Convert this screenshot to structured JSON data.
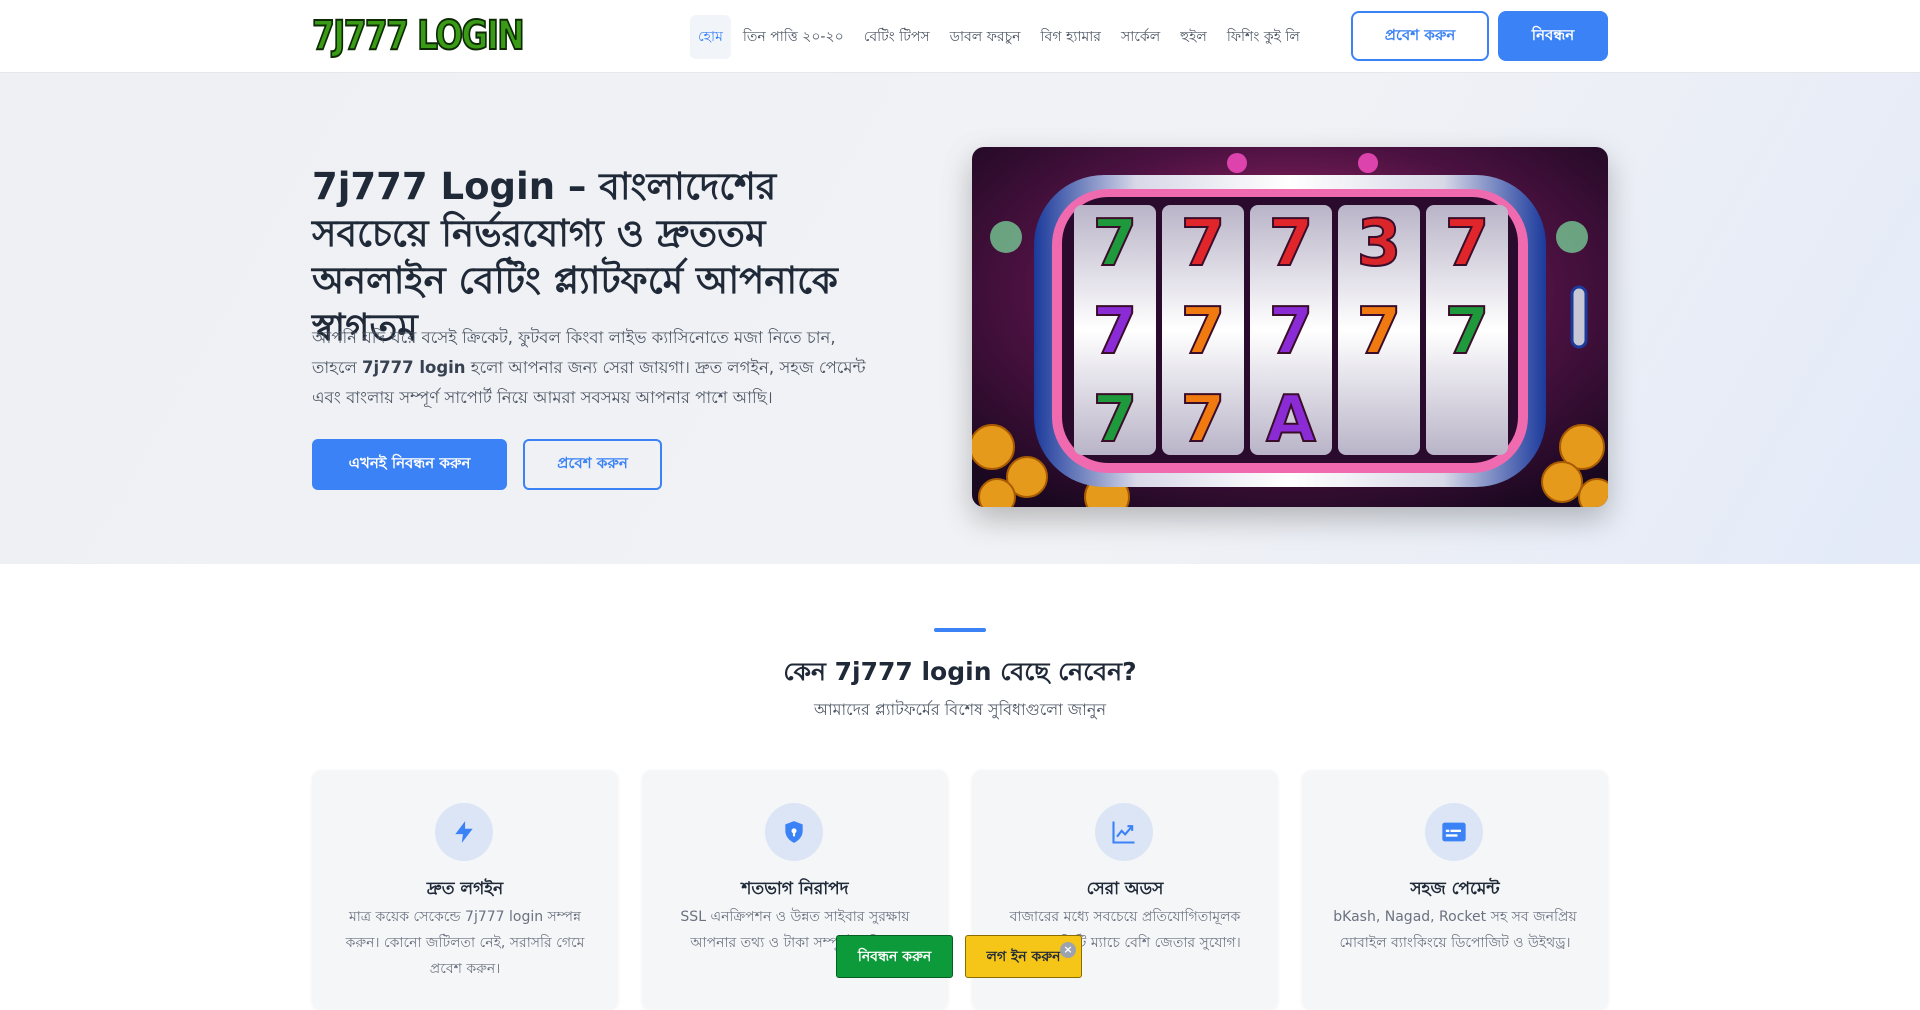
{
  "nav": {
    "logo_text": "7J777 LOGIN",
    "items": [
      "হোম",
      "তিন পাত্তি ২০-২০",
      "বেটিং টিপস",
      "ডাবল ফরচুন",
      "বিগ হ্যামার",
      "সার্কেল",
      "হুইল",
      "ফিশিং কুই লি"
    ],
    "active_index": 0,
    "login_label": "প্রবেশ করুন",
    "register_label": "নিবন্ধন"
  },
  "hero": {
    "title": "7j777 Login – বাংলাদেশের সবচেয়ে নির্ভরযোগ্য ও দ্রুততম অনলাইন বেটিং প্ল্যাটফর্মে আপনাকে স্বাগতম",
    "desc_before": "আপনি যদি ঘরে বসেই ক্রিকেট, ফুটবল কিংবা লাইভ ক্যাসিনোতে মজা নিতে চান, তাহলে ",
    "desc_bold": "7j777 login",
    "desc_after": " হলো আপনার জন্য সেরা জায়গা। দ্রুত লগইন, সহজ পেমেন্ট এবং বাংলায় সম্পূর্ণ সাপোর্ট নিয়ে আমরা সবসময় আপনার পাশে আছি।",
    "primary_button": "এখনই নিবন্ধন করুন",
    "secondary_button": "প্রবেশ করুন",
    "slot_reels": [
      [
        "7",
        "7",
        "7",
        "3",
        "7"
      ],
      [
        "7",
        "7",
        "7",
        "7",
        "7"
      ],
      [
        "7",
        "7",
        "A",
        "",
        ""
      ]
    ]
  },
  "features": {
    "title": "কেন 7j777 login বেছে নেবেন?",
    "subtitle": "আমাদের প্ল্যাটফর্মের বিশেষ সুবিধাগুলো জানুন",
    "cards": [
      {
        "icon": "lightning-icon",
        "title": "দ্রুত লগইন",
        "text": "মাত্র কয়েক সেকেন্ডে 7j777 login সম্পন্ন করুন। কোনো জটিলতা নেই, সরাসরি গেমে প্রবেশ করুন।"
      },
      {
        "icon": "shield-lock-icon",
        "title": "শতভাগ নিরাপদ",
        "text": "SSL এনক্রিপশন ও উন্নত সাইবার সুরক্ষায় আপনার তথ্য ও টাকা সম্পূর্ণ সুরক্ষিত।"
      },
      {
        "icon": "chart-trend-icon",
        "title": "সেরা অডস",
        "text": "বাজারের মধ্যে সবচেয়ে প্রতিযোগিতামূলক অডস, প্রতিটি ম্যাচে বেশি জেতার সুযোগ।"
      },
      {
        "icon": "card-payment-icon",
        "title": "সহজ পেমেন্ট",
        "text": "bKash, Nagad, Rocket সহ সব জনপ্রিয় মোবাইল ব্যাংকিংয়ে ডিপোজিট ও উইথড্র।"
      }
    ]
  },
  "floating": {
    "register_label": "নিবন্ধন করুন",
    "login_label": "লগ ইন করুন",
    "close_glyph": "×"
  },
  "colors": {
    "accent": "#3b82f6",
    "float_green": "#0c9a3a",
    "float_yellow": "#f5c518"
  }
}
